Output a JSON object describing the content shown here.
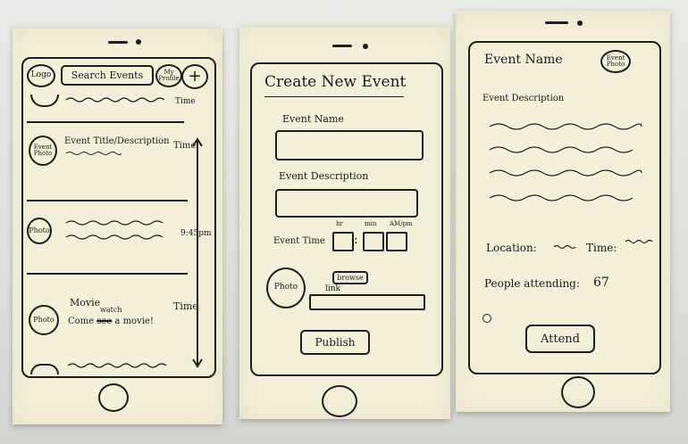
{
  "screens": {
    "browse": {
      "logo_label": "Logo",
      "search_label": "Search Events",
      "profile_label": "My Profile",
      "add_label": "+",
      "top_time": "Time",
      "event1": {
        "photo": "Event Photo",
        "title": "Event Title/Description",
        "time": "Time"
      },
      "event2": {
        "photo": "Photo",
        "time": "9:45pm"
      },
      "event3": {
        "photo": "Photo",
        "line1": "Movie",
        "line2": "Come",
        "line2b": "a movie!",
        "struck": "see",
        "inserted": "watch",
        "time": "Time"
      }
    },
    "create": {
      "title": "Create New Event",
      "name_label": "Event Name",
      "desc_label": "Event Description",
      "time_label": "Event Time",
      "hr_label": "hr",
      "min_label": "min",
      "ampm_label": "AM/pm",
      "colon": ":",
      "photo_label": "Photo",
      "browse_label": "browse",
      "link_label": "link",
      "publish_label": "Publish"
    },
    "detail": {
      "name": "Event Name",
      "photo_label": "Event Photo",
      "desc_label": "Event Description",
      "location_label": "Location:",
      "time_label": "Time:",
      "attending_label": "People attending:",
      "attending_count": "67",
      "attend_label": "Attend"
    }
  }
}
